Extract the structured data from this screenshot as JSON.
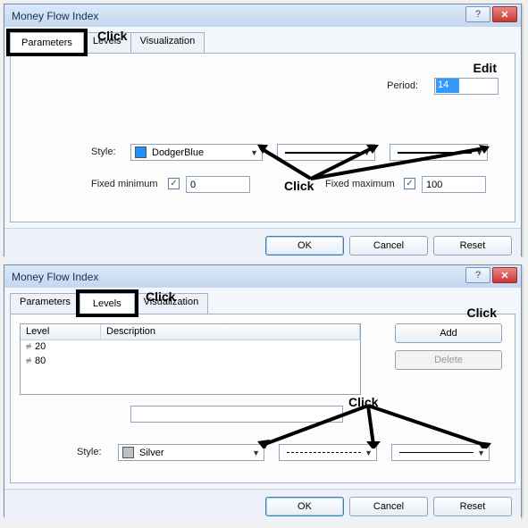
{
  "dialog1": {
    "title": "Money Flow Index",
    "tabs": {
      "parameters": "Parameters",
      "levels": "Levels",
      "visualization": "Visualization",
      "active": "parameters"
    },
    "period_label": "Period:",
    "period_value": "14",
    "style_label": "Style:",
    "color_name": "DodgerBlue",
    "color_hex": "#1e90ff",
    "fixed_min_label": "Fixed minimum",
    "fixed_min_checked": true,
    "fixed_min_value": "0",
    "fixed_max_label": "Fixed maximum",
    "fixed_max_checked": true,
    "fixed_max_value": "100",
    "buttons": {
      "ok": "OK",
      "cancel": "Cancel",
      "reset": "Reset"
    },
    "annotations": {
      "click_tabs": "Click",
      "edit": "Edit",
      "click_style": "Click"
    }
  },
  "dialog2": {
    "title": "Money Flow Index",
    "tabs": {
      "parameters": "Parameters",
      "levels": "Levels",
      "visualization": "Visualization",
      "active": "levels"
    },
    "table": {
      "col_level": "Level",
      "col_desc": "Description",
      "rows": [
        {
          "level": "20",
          "desc": ""
        },
        {
          "level": "80",
          "desc": ""
        }
      ]
    },
    "add_label": "Add",
    "delete_label": "Delete",
    "style_label": "Style:",
    "color_name": "Silver",
    "color_hex": "#c0c0c0",
    "buttons": {
      "ok": "OK",
      "cancel": "Cancel",
      "reset": "Reset"
    },
    "annotations": {
      "click_tabs": "Click",
      "click_add": "Click",
      "click_style": "Click"
    }
  }
}
